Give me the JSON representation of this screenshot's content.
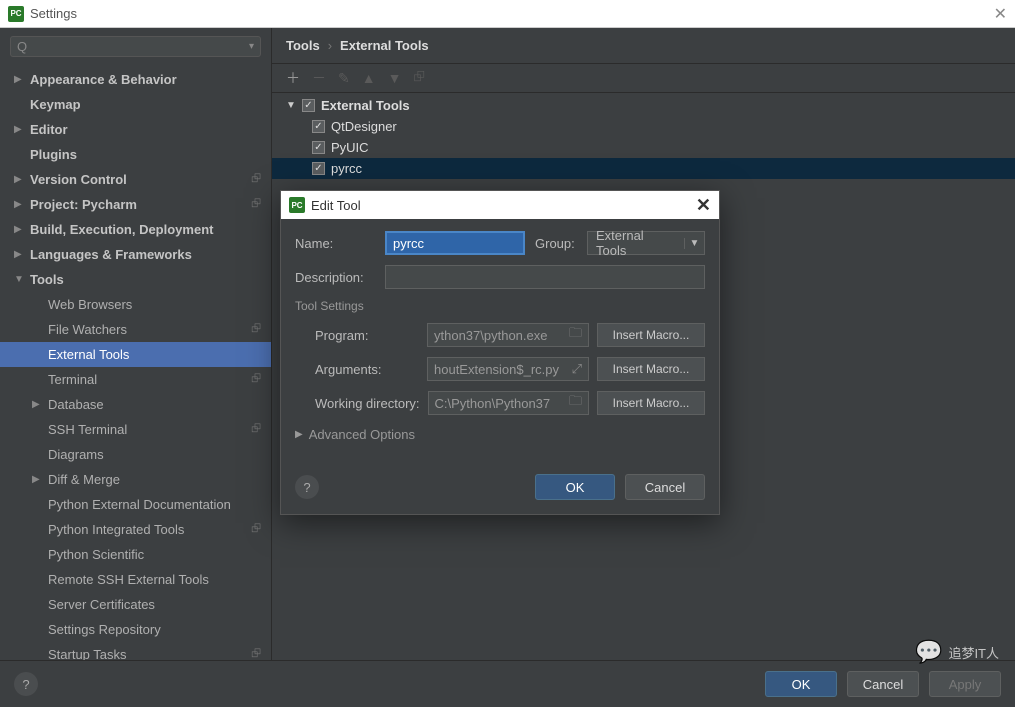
{
  "window": {
    "title": "Settings"
  },
  "search": {
    "placeholder": ""
  },
  "sidebar": [
    {
      "label": "Appearance & Behavior",
      "kind": "collapsed"
    },
    {
      "label": "Keymap",
      "kind": "leaf"
    },
    {
      "label": "Editor",
      "kind": "collapsed"
    },
    {
      "label": "Plugins",
      "kind": "leaf"
    },
    {
      "label": "Version Control",
      "kind": "collapsed",
      "badge": true
    },
    {
      "label": "Project: Pycharm",
      "kind": "collapsed",
      "badge": true
    },
    {
      "label": "Build, Execution, Deployment",
      "kind": "collapsed"
    },
    {
      "label": "Languages & Frameworks",
      "kind": "collapsed"
    },
    {
      "label": "Tools",
      "kind": "expanded",
      "children": [
        {
          "label": "Web Browsers"
        },
        {
          "label": "File Watchers",
          "badge": true
        },
        {
          "label": "External Tools",
          "selected": true
        },
        {
          "label": "Terminal",
          "badge": true
        },
        {
          "label": "Database",
          "kind": "collapsed"
        },
        {
          "label": "SSH Terminal",
          "badge": true
        },
        {
          "label": "Diagrams"
        },
        {
          "label": "Diff & Merge",
          "kind": "collapsed"
        },
        {
          "label": "Python External Documentation"
        },
        {
          "label": "Python Integrated Tools",
          "badge": true
        },
        {
          "label": "Python Scientific"
        },
        {
          "label": "Remote SSH External Tools"
        },
        {
          "label": "Server Certificates"
        },
        {
          "label": "Settings Repository"
        },
        {
          "label": "Startup Tasks",
          "badge": true
        }
      ]
    }
  ],
  "breadcrumb": {
    "root": "Tools",
    "leaf": "External Tools"
  },
  "extTools": {
    "group": "External Tools",
    "items": [
      {
        "label": "QtDesigner"
      },
      {
        "label": "PyUIC"
      },
      {
        "label": "pyrcc",
        "selected": true
      }
    ]
  },
  "dialog": {
    "title": "Edit Tool",
    "nameLabel": "Name:",
    "nameValue": "pyrcc",
    "groupLabel": "Group:",
    "groupValue": "External Tools",
    "descLabel": "Description:",
    "descValue": "",
    "toolSettings": "Tool Settings",
    "programLabel": "Program:",
    "programValue": "ython37\\python.exe",
    "argsLabel": "Arguments:",
    "argsValue": "houtExtension$_rc.py",
    "wdLabel": "Working directory:",
    "wdValue": "C:\\Python\\Python37",
    "macro": "Insert Macro...",
    "advanced": "Advanced Options",
    "ok": "OK",
    "cancel": "Cancel"
  },
  "footer": {
    "ok": "OK",
    "cancel": "Cancel",
    "apply": "Apply"
  },
  "watermark": "追梦IT人"
}
